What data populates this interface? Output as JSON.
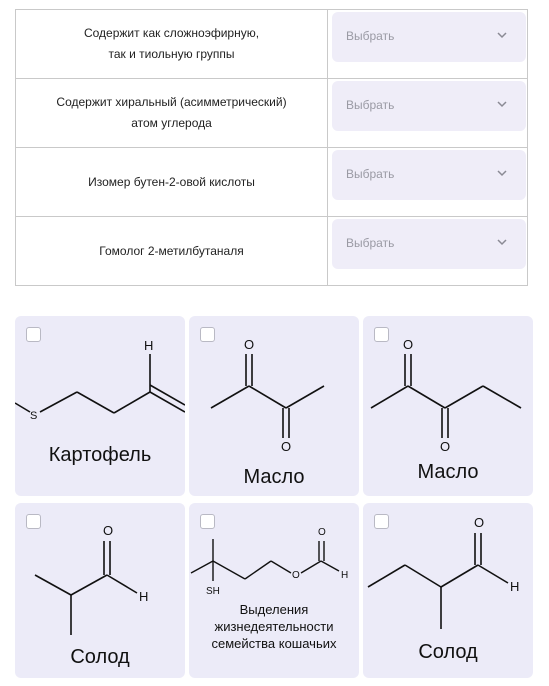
{
  "table": {
    "placeholder": "Выбрать",
    "rows": [
      {
        "label_line1": "Содержит как сложноэфирную,",
        "label_line2": "так и тиольную группы"
      },
      {
        "label_line1": "Содержит хиральный (асимметрический)",
        "label_line2": "атом углерода"
      },
      {
        "label_line1": "Изомер бутен-2-овой кислоты",
        "label_line2": ""
      },
      {
        "label_line1": "Гомолог 2-метилбутаналя",
        "label_line2": ""
      }
    ]
  },
  "cards": [
    {
      "caption": "Картофель",
      "atoms": [
        "H",
        "S"
      ]
    },
    {
      "caption": "Масло",
      "atoms": [
        "O",
        "O"
      ]
    },
    {
      "caption": "Масло",
      "atoms": [
        "O",
        "O"
      ]
    },
    {
      "caption": "Солод",
      "atoms": [
        "O",
        "H"
      ]
    },
    {
      "caption_lines": [
        "Выделения",
        "жизнедеятельности",
        "семейства кошачьих"
      ],
      "atoms": [
        "SH",
        "O",
        "O",
        "H"
      ]
    },
    {
      "caption": "Солод",
      "atoms": [
        "O",
        "H"
      ]
    }
  ],
  "colors": {
    "select_bg": "#efedf8",
    "card_bg": "#ecebf8",
    "border": "#c9c9c9"
  }
}
